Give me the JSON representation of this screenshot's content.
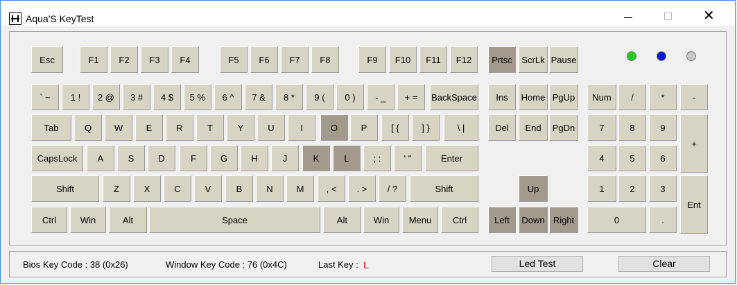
{
  "window": {
    "title": "Aqua'S KeyTest",
    "minimize_glyph": "—",
    "maximize_glyph": "☐",
    "close_glyph": "✕"
  },
  "keys": [
    {
      "id": "esc",
      "label": "Esc",
      "on": false
    },
    {
      "id": "f1",
      "label": "F1",
      "on": false
    },
    {
      "id": "f2",
      "label": "F2",
      "on": false
    },
    {
      "id": "f3",
      "label": "F3",
      "on": false
    },
    {
      "id": "f4",
      "label": "F4",
      "on": false
    },
    {
      "id": "f5",
      "label": "F5",
      "on": false
    },
    {
      "id": "f6",
      "label": "F6",
      "on": false
    },
    {
      "id": "f7",
      "label": "F7",
      "on": false
    },
    {
      "id": "f8",
      "label": "F8",
      "on": false
    },
    {
      "id": "f9",
      "label": "F9",
      "on": false
    },
    {
      "id": "f10",
      "label": "F10",
      "on": false
    },
    {
      "id": "f11",
      "label": "F11",
      "on": false
    },
    {
      "id": "f12",
      "label": "F12",
      "on": false
    },
    {
      "id": "prtsc",
      "label": "Prtsc",
      "on": true
    },
    {
      "id": "scrlk",
      "label": "ScrLk",
      "on": false
    },
    {
      "id": "pause",
      "label": "Pause",
      "on": false
    },
    {
      "id": "backtick",
      "label": "` ~",
      "on": false
    },
    {
      "id": "n1",
      "label": "1 !",
      "on": false
    },
    {
      "id": "n2",
      "label": "2 @",
      "on": false
    },
    {
      "id": "n3",
      "label": "3 #",
      "on": false
    },
    {
      "id": "n4",
      "label": "4 $",
      "on": false
    },
    {
      "id": "n5",
      "label": "5 %",
      "on": false
    },
    {
      "id": "n6",
      "label": "6 ^",
      "on": false
    },
    {
      "id": "n7",
      "label": "7 &",
      "on": false
    },
    {
      "id": "n8",
      "label": "8 *",
      "on": false
    },
    {
      "id": "n9",
      "label": "9 (",
      "on": false
    },
    {
      "id": "n0",
      "label": "0 )",
      "on": false
    },
    {
      "id": "minus",
      "label": "- _",
      "on": false
    },
    {
      "id": "equal",
      "label": "+ =",
      "on": false
    },
    {
      "id": "backspace",
      "label": "BackSpace",
      "on": false
    },
    {
      "id": "tab",
      "label": "Tab",
      "on": false
    },
    {
      "id": "q",
      "label": "Q",
      "on": false
    },
    {
      "id": "w",
      "label": "W",
      "on": false
    },
    {
      "id": "e",
      "label": "E",
      "on": false
    },
    {
      "id": "r",
      "label": "R",
      "on": false
    },
    {
      "id": "t",
      "label": "T",
      "on": false
    },
    {
      "id": "y",
      "label": "Y",
      "on": false
    },
    {
      "id": "u",
      "label": "U",
      "on": false
    },
    {
      "id": "i",
      "label": "I",
      "on": false
    },
    {
      "id": "o",
      "label": "O",
      "on": true
    },
    {
      "id": "p",
      "label": "P",
      "on": false
    },
    {
      "id": "lbracket",
      "label": "[ {",
      "on": false
    },
    {
      "id": "rbracket",
      "label": "] }",
      "on": false
    },
    {
      "id": "backslash",
      "label": "\\ |",
      "on": false
    },
    {
      "id": "capslock",
      "label": "CapsLock",
      "on": false
    },
    {
      "id": "a",
      "label": "A",
      "on": false
    },
    {
      "id": "s",
      "label": "S",
      "on": false
    },
    {
      "id": "d",
      "label": "D",
      "on": false
    },
    {
      "id": "f",
      "label": "F",
      "on": false
    },
    {
      "id": "g",
      "label": "G",
      "on": false
    },
    {
      "id": "h",
      "label": "H",
      "on": false
    },
    {
      "id": "j",
      "label": "J",
      "on": false
    },
    {
      "id": "k",
      "label": "K",
      "on": true
    },
    {
      "id": "l",
      "label": "L",
      "on": true
    },
    {
      "id": "semicolon",
      "label": "; :",
      "on": false
    },
    {
      "id": "quote",
      "label": "' \"",
      "on": false
    },
    {
      "id": "enter",
      "label": "Enter",
      "on": false
    },
    {
      "id": "lshift",
      "label": "Shift",
      "on": false
    },
    {
      "id": "z",
      "label": "Z",
      "on": false
    },
    {
      "id": "x",
      "label": "X",
      "on": false
    },
    {
      "id": "c",
      "label": "C",
      "on": false
    },
    {
      "id": "v",
      "label": "V",
      "on": false
    },
    {
      "id": "b",
      "label": "B",
      "on": false
    },
    {
      "id": "n",
      "label": "N",
      "on": false
    },
    {
      "id": "m",
      "label": "M",
      "on": false
    },
    {
      "id": "comma",
      "label": ", <",
      "on": false
    },
    {
      "id": "period",
      "label": ". >",
      "on": false
    },
    {
      "id": "slash",
      "label": "/ ?",
      "on": false
    },
    {
      "id": "rshift",
      "label": "Shift",
      "on": false
    },
    {
      "id": "lctrl",
      "label": "Ctrl",
      "on": false
    },
    {
      "id": "lwin",
      "label": "Win",
      "on": false
    },
    {
      "id": "lalt",
      "label": "Alt",
      "on": false
    },
    {
      "id": "space",
      "label": "Space",
      "on": false
    },
    {
      "id": "ralt",
      "label": "Alt",
      "on": false
    },
    {
      "id": "rwin",
      "label": "Win",
      "on": false
    },
    {
      "id": "menu",
      "label": "Menu",
      "on": false
    },
    {
      "id": "rctrl",
      "label": "Ctrl",
      "on": false
    },
    {
      "id": "ins",
      "label": "Ins",
      "on": false
    },
    {
      "id": "home",
      "label": "Home",
      "on": false
    },
    {
      "id": "pgup",
      "label": "PgUp",
      "on": false
    },
    {
      "id": "del",
      "label": "Del",
      "on": false
    },
    {
      "id": "end",
      "label": "End",
      "on": false
    },
    {
      "id": "pgdn",
      "label": "PgDn",
      "on": false
    },
    {
      "id": "up",
      "label": "Up",
      "on": true
    },
    {
      "id": "left",
      "label": "Left",
      "on": true
    },
    {
      "id": "down",
      "label": "Down",
      "on": true
    },
    {
      "id": "right",
      "label": "Right",
      "on": true
    },
    {
      "id": "num",
      "label": "Num",
      "on": false
    },
    {
      "id": "kp_div",
      "label": "/",
      "on": false
    },
    {
      "id": "kp_mul",
      "label": "*",
      "on": false
    },
    {
      "id": "kp_minus",
      "label": "-",
      "on": false
    },
    {
      "id": "kp7",
      "label": "7",
      "on": false
    },
    {
      "id": "kp8",
      "label": "8",
      "on": false
    },
    {
      "id": "kp9",
      "label": "9",
      "on": false
    },
    {
      "id": "kp_plus",
      "label": "+",
      "on": false
    },
    {
      "id": "kp4",
      "label": "4",
      "on": false
    },
    {
      "id": "kp5",
      "label": "5",
      "on": false
    },
    {
      "id": "kp6",
      "label": "6",
      "on": false
    },
    {
      "id": "kp1",
      "label": "1",
      "on": false
    },
    {
      "id": "kp2",
      "label": "2",
      "on": false
    },
    {
      "id": "kp3",
      "label": "3",
      "on": false
    },
    {
      "id": "kp_enter",
      "label": "Ent",
      "on": false
    },
    {
      "id": "kp0",
      "label": "0",
      "on": false
    },
    {
      "id": "kp_dot",
      "label": ".",
      "on": false
    }
  ],
  "leds": [
    {
      "name": "numlock-led",
      "color": "#22cc22"
    },
    {
      "name": "capslock-led",
      "color": "#0a14d8"
    },
    {
      "name": "scrolllock-led",
      "color": "#c8c8c8"
    }
  ],
  "status": {
    "bios_key_code": "Bios Key Code : 38 (0x26)",
    "window_key_code": "Window Key Code : 76 (0x4C)",
    "last_key_label": "Last Key :",
    "last_key_value": "L",
    "led_test_button": "Led Test",
    "clear_button": "Clear"
  },
  "colors": {
    "key_normal": "#d8d4c4",
    "key_pressed": "#a49a8c",
    "last_key": "#e00000"
  }
}
